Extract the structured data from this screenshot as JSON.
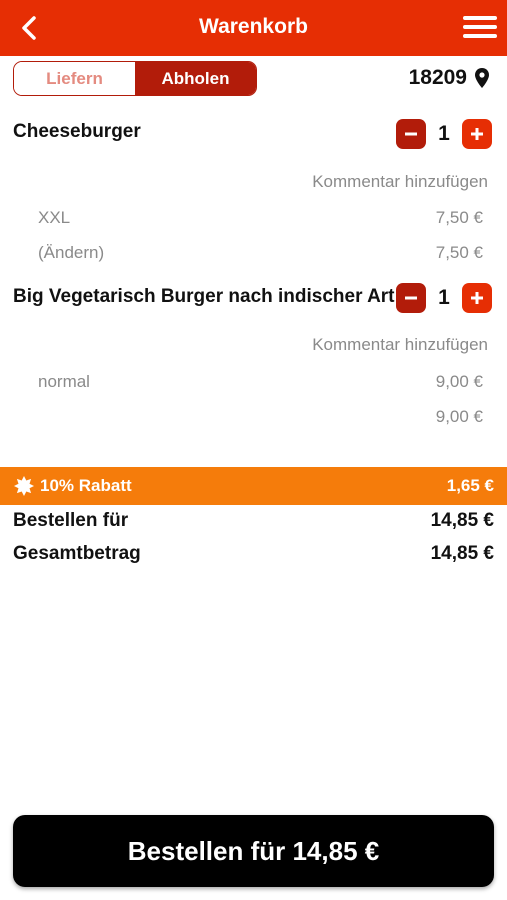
{
  "header": {
    "title": "Warenkorb"
  },
  "mode": {
    "deliver_label": "Liefern",
    "pickup_label": "Abholen"
  },
  "location": {
    "zip": "18209"
  },
  "items": [
    {
      "name": "Cheeseburger",
      "quantity": "1",
      "comment_label": "Kommentar hinzufügen",
      "options": [
        {
          "label": "XXL",
          "price": "7,50 €"
        },
        {
          "label": "(Ändern)",
          "price": "7,50 €"
        }
      ]
    },
    {
      "name": "Big Vegetarisch Burger nach indischer Art",
      "quantity": "1",
      "comment_label": "Kommentar hinzufügen",
      "options": [
        {
          "label": "normal",
          "price": "9,00 €"
        },
        {
          "label": "",
          "price": "9,00 €"
        }
      ]
    }
  ],
  "discount": {
    "label": "10% Rabatt",
    "value": "1,65 €"
  },
  "summary": {
    "order_for_label": "Bestellen für",
    "order_for_value": "14,85 €",
    "total_label": "Gesamtbetrag",
    "total_value": "14,85 €"
  },
  "order_button": {
    "label": "Bestellen für 14,85 €"
  },
  "colors": {
    "header": "#e62e04",
    "dark_red": "#b21c0a",
    "discount": "#f57c0b"
  },
  "icons": [
    "back-arrow-icon",
    "menu-icon",
    "location-pin-icon",
    "minus-icon",
    "plus-icon",
    "badge-icon"
  ]
}
